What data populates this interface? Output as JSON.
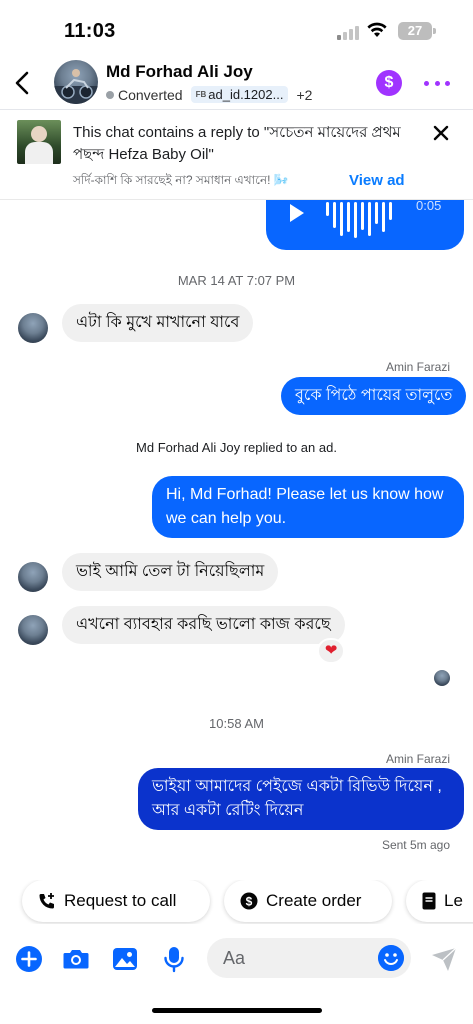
{
  "status_bar": {
    "time": "11:03",
    "battery": "27"
  },
  "header": {
    "contact_name": "Md Forhad Ali Joy",
    "status": "Converted",
    "tag": "ad_id.1202...",
    "tag_prefix": "FB",
    "extra_count": "+2",
    "dollar_symbol": "$"
  },
  "ad_banner": {
    "title": "This chat contains a reply to \"সচেতন মায়েদের প্রথম পছন্দ Hefza Baby Oil\"",
    "subtitle": "সর্দি-কাশি কি সারছেই না? সমাধান এখানে! 🌬️",
    "view_ad_label": "View ad"
  },
  "messages": {
    "audio_duration": "0:05",
    "date_divider": "MAR 14 AT 7:07 PM",
    "msg1": "এটা কি মুখে মাখানো যাবে",
    "sender1": "Amin Farazi",
    "msg2": "বুকে পিঠে পায়ের তালুতে",
    "ad_reply_notice": "Md Forhad Ali Joy replied to an ad.",
    "msg3": "Hi, Md Forhad! Please let us know how we can help you.",
    "msg4": "ভাই আমি তেল টা নিয়েছিলাম",
    "msg5": "এখনো ব্যাবহার করছি ভালো কাজ করছে",
    "reaction": "❤",
    "time_divider": "10:58 AM",
    "sender2": "Amin Farazi",
    "msg6": "ভাইয়া আমাদের পেইজে একটা রিভিউ দিয়েন , আর একটা রেটিং দিয়েন",
    "sent_status": "Sent 5m ago"
  },
  "quick_actions": {
    "request_call": "Request to call",
    "create_order": "Create order",
    "third": "Le"
  },
  "composer": {
    "placeholder": "Aa"
  },
  "colors": {
    "accent": "#0866ff",
    "dark_bubble": "#0b33cc",
    "purple": "#a033ff"
  }
}
